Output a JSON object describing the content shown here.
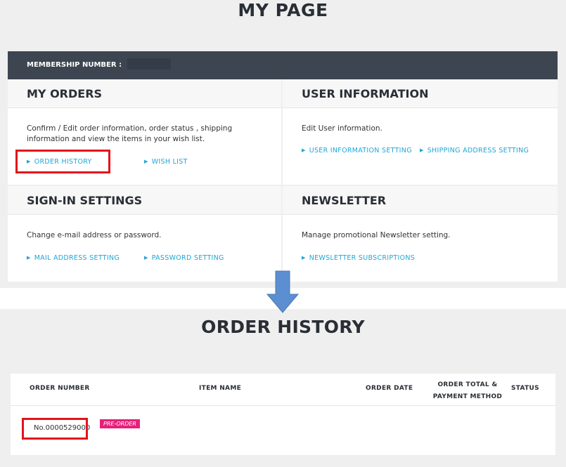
{
  "page_title": "MY PAGE",
  "membership": {
    "label": "MEMBERSHIP NUMBER :"
  },
  "panels": {
    "my_orders": {
      "title": "MY ORDERS",
      "description_line1": "Confirm / Edit order information, order status , shipping",
      "description_line2": "information and view the items in your wish list.",
      "links": [
        "ORDER HISTORY",
        "WISH LIST"
      ]
    },
    "user_information": {
      "title": "USER INFORMATION",
      "description": "Edit User information.",
      "links": [
        "USER INFORMATION SETTING",
        "SHIPPING ADDRESS SETTING"
      ]
    },
    "sign_in_settings": {
      "title": "SIGN-IN SETTINGS",
      "description": "Change e-mail address or password.",
      "links": [
        "MAIL ADDRESS SETTING",
        "PASSWORD SETTING"
      ]
    },
    "newsletter": {
      "title": "NEWSLETTER",
      "description": "Manage promotional Newsletter setting.",
      "links": [
        "NEWSLETTER SUBSCRIPTIONS"
      ]
    }
  },
  "order_history": {
    "title": "ORDER HISTORY",
    "columns": {
      "order_number": "ORDER NUMBER",
      "item_name": "ITEM NAME",
      "order_date": "ORDER DATE",
      "order_total_line1": "ORDER TOTAL &",
      "order_total_line2": "PAYMENT METHOD",
      "status": "STATUS"
    },
    "rows": [
      {
        "order_number": "No.0000529000",
        "badge": "PRE-ORDER"
      }
    ]
  },
  "colors": {
    "header_bar": "#3c4550",
    "link": "#1ea6d6",
    "highlight": "#e3131b",
    "badge": "#e5217b",
    "arrow": "#5b8fd1"
  },
  "icons": {
    "link_marker": "triangle-right-icon",
    "flow_arrow": "arrow-down-icon"
  }
}
